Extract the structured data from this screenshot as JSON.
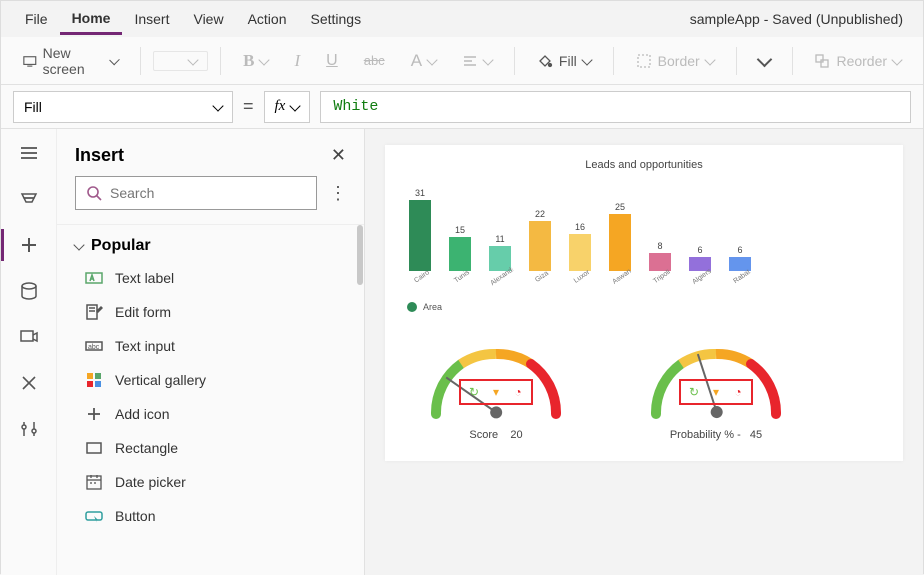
{
  "menubar": {
    "items": [
      "File",
      "Home",
      "Insert",
      "View",
      "Action",
      "Settings"
    ],
    "active_index": 1,
    "app_title": "sampleApp - Saved (Unpublished)"
  },
  "toolbar": {
    "new_screen": "New screen",
    "fill_label": "Fill",
    "border_label": "Border",
    "reorder_label": "Reorder"
  },
  "formulabar": {
    "property": "Fill",
    "fx": "fx",
    "formula": "White"
  },
  "insert_panel": {
    "title": "Insert",
    "search_placeholder": "Search",
    "section": "Popular",
    "items": [
      {
        "label": "Text label",
        "icon": "text-label"
      },
      {
        "label": "Edit form",
        "icon": "edit-form"
      },
      {
        "label": "Text input",
        "icon": "text-input"
      },
      {
        "label": "Vertical gallery",
        "icon": "vertical-gallery"
      },
      {
        "label": "Add icon",
        "icon": "add-icon"
      },
      {
        "label": "Rectangle",
        "icon": "rectangle"
      },
      {
        "label": "Date picker",
        "icon": "date-picker"
      },
      {
        "label": "Button",
        "icon": "button"
      }
    ]
  },
  "canvas": {
    "chart_title": "Leads and opportunities",
    "legend": "Area",
    "gauge1": {
      "label": "Score",
      "value": "20",
      "angle": -55
    },
    "gauge2": {
      "label": "Probability % -",
      "value": "45",
      "angle": -18
    }
  },
  "chart_data": {
    "type": "bar",
    "title": "Leads and opportunities",
    "categories": [
      "Cairo",
      "Tunis",
      "Alexandria",
      "Giza",
      "Luxor",
      "Aswan",
      "Tripoli",
      "Algiers",
      "Rabat"
    ],
    "values": [
      31,
      15,
      11,
      22,
      16,
      25,
      8,
      6,
      6
    ],
    "colors": [
      "#2e8b57",
      "#3cb371",
      "#66cdaa",
      "#f4b942",
      "#f8d26a",
      "#f5a623",
      "#db7093",
      "#9370db",
      "#6495ed"
    ],
    "ylim": [
      0,
      35
    ],
    "legend": [
      "Area"
    ]
  }
}
